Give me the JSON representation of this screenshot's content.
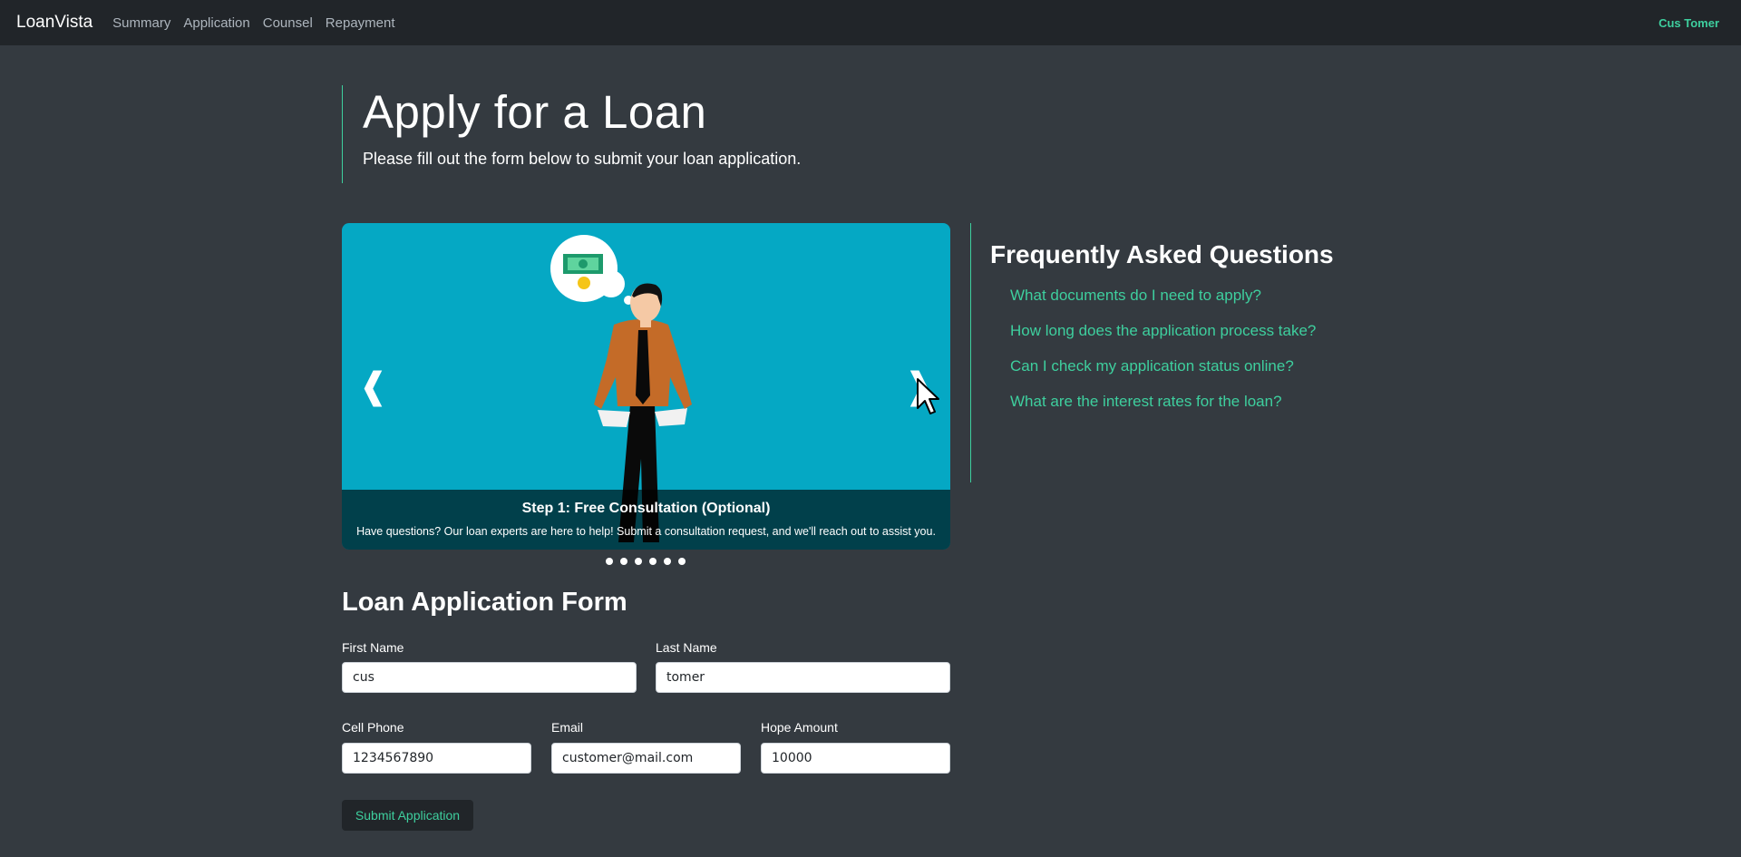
{
  "nav": {
    "brand": "LoanVista",
    "links": [
      "Summary",
      "Application",
      "Counsel",
      "Repayment"
    ],
    "user": "Cus Tomer"
  },
  "header": {
    "title": "Apply for a Loan",
    "subtitle": "Please fill out the form below to submit your loan application."
  },
  "carousel": {
    "prev_glyph": "❰",
    "next_glyph": "❱",
    "caption_title": "Step 1: Free Consultation (Optional)",
    "caption_text": "Have questions? Our loan experts are here to help! Submit a consultation request, and we'll reach out to assist you.",
    "slide_count": 6,
    "active_slide": 1,
    "background_color": "#05a8c4"
  },
  "faq": {
    "title": "Frequently Asked Questions",
    "items": [
      "What documents do I need to apply?",
      "How long does the application process take?",
      "Can I check my application status online?",
      "What are the interest rates for the loan?"
    ]
  },
  "form": {
    "title": "Loan Application Form",
    "first_name": {
      "label": "First Name",
      "value": "cus"
    },
    "last_name": {
      "label": "Last Name",
      "value": "tomer"
    },
    "cell_phone": {
      "label": "Cell Phone",
      "value": "1234567890"
    },
    "email": {
      "label": "Email",
      "value": "customer@mail.com"
    },
    "hope_amount": {
      "label": "Hope Amount",
      "value": "10000"
    },
    "submit_label": "Submit Application"
  },
  "colors": {
    "accent": "#3ecf9e",
    "page_bg": "#343a40",
    "navbar_bg": "#212529"
  }
}
